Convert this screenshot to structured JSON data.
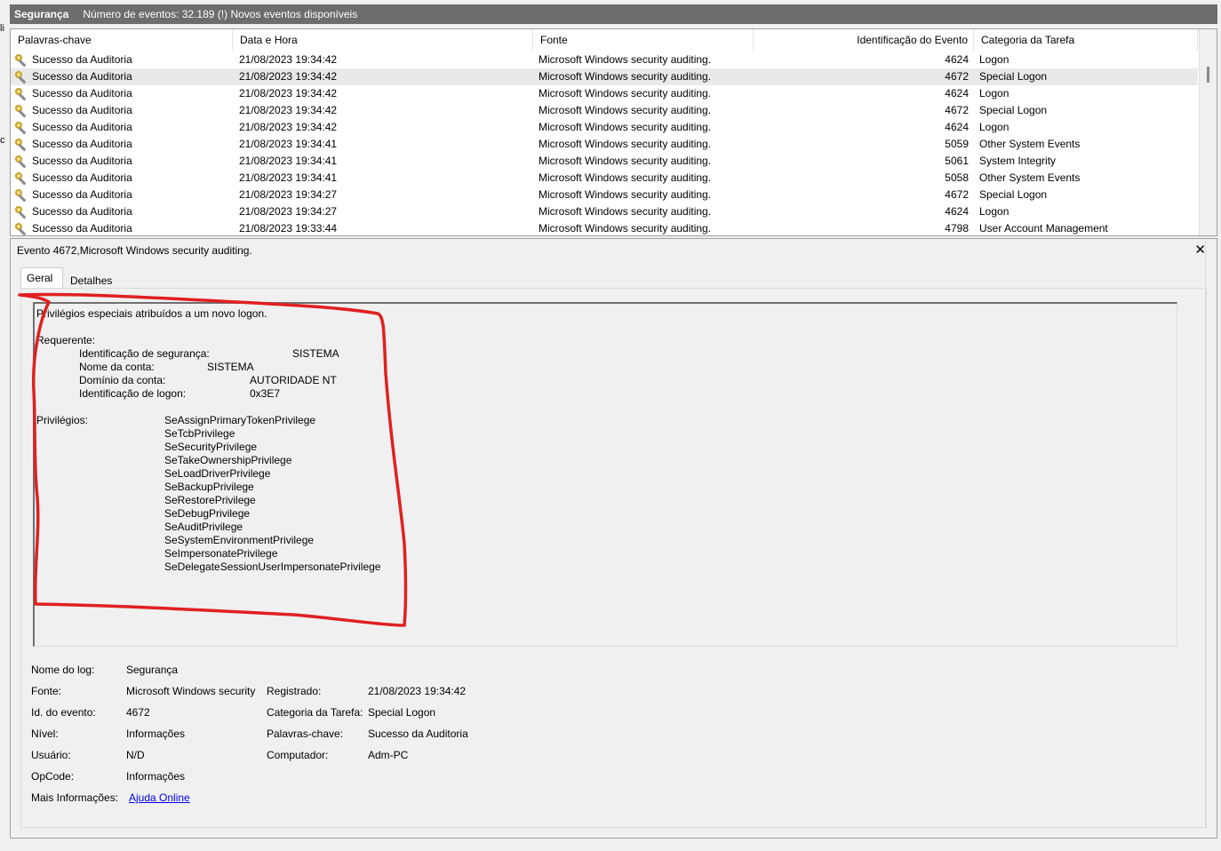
{
  "window": {
    "log_name": "Segurança",
    "event_count_text": "Número de eventos: 32.189 (!) Novos eventos disponíveis"
  },
  "list": {
    "columns": [
      "Palavras-chave",
      "Data e Hora",
      "Fonte",
      "Identificação do Evento",
      "Categoria da Tarefa"
    ],
    "rows": [
      {
        "kw": "Sucesso da Auditoria",
        "dt": "21/08/2023 19:34:42",
        "src": "Microsoft Windows security auditing.",
        "id": "4624",
        "cat": "Logon"
      },
      {
        "kw": "Sucesso da Auditoria",
        "dt": "21/08/2023 19:34:42",
        "src": "Microsoft Windows security auditing.",
        "id": "4672",
        "cat": "Special Logon"
      },
      {
        "kw": "Sucesso da Auditoria",
        "dt": "21/08/2023 19:34:42",
        "src": "Microsoft Windows security auditing.",
        "id": "4624",
        "cat": "Logon"
      },
      {
        "kw": "Sucesso da Auditoria",
        "dt": "21/08/2023 19:34:42",
        "src": "Microsoft Windows security auditing.",
        "id": "4672",
        "cat": "Special Logon"
      },
      {
        "kw": "Sucesso da Auditoria",
        "dt": "21/08/2023 19:34:42",
        "src": "Microsoft Windows security auditing.",
        "id": "4624",
        "cat": "Logon"
      },
      {
        "kw": "Sucesso da Auditoria",
        "dt": "21/08/2023 19:34:41",
        "src": "Microsoft Windows security auditing.",
        "id": "5059",
        "cat": "Other System Events"
      },
      {
        "kw": "Sucesso da Auditoria",
        "dt": "21/08/2023 19:34:41",
        "src": "Microsoft Windows security auditing.",
        "id": "5061",
        "cat": "System Integrity"
      },
      {
        "kw": "Sucesso da Auditoria",
        "dt": "21/08/2023 19:34:41",
        "src": "Microsoft Windows security auditing.",
        "id": "5058",
        "cat": "Other System Events"
      },
      {
        "kw": "Sucesso da Auditoria",
        "dt": "21/08/2023 19:34:27",
        "src": "Microsoft Windows security auditing.",
        "id": "4672",
        "cat": "Special Logon"
      },
      {
        "kw": "Sucesso da Auditoria",
        "dt": "21/08/2023 19:34:27",
        "src": "Microsoft Windows security auditing.",
        "id": "4624",
        "cat": "Logon"
      },
      {
        "kw": "Sucesso da Auditoria",
        "dt": "21/08/2023 19:33:44",
        "src": "Microsoft Windows security auditing.",
        "id": "4798",
        "cat": "User Account Management"
      }
    ],
    "selected_index": 1
  },
  "detail": {
    "title": "Evento 4672,Microsoft Windows security auditing.",
    "tabs": [
      "Geral",
      "Detalhes"
    ],
    "message": {
      "summary": "Privilégios especiais atribuídos a um novo logon.",
      "requester_label": "Requerente:",
      "sid_label": "Identificação de segurança:",
      "sid_value": "SISTEMA",
      "account_label": "Nome da conta:",
      "account_value": "SISTEMA",
      "domain_label": "Domínio da conta:",
      "domain_value": "AUTORIDADE NT",
      "logon_id_label": "Identificação de logon:",
      "logon_id_value": "0x3E7",
      "privileges_label": "Privilégios:",
      "privileges": [
        "SeAssignPrimaryTokenPrivilege",
        "SeTcbPrivilege",
        "SeSecurityPrivilege",
        "SeTakeOwnershipPrivilege",
        "SeLoadDriverPrivilege",
        "SeBackupPrivilege",
        "SeRestorePrivilege",
        "SeDebugPrivilege",
        "SeAuditPrivilege",
        "SeSystemEnvironmentPrivilege",
        "SeImpersonatePrivilege",
        "SeDelegateSessionUserImpersonatePrivilege"
      ]
    },
    "properties": {
      "log_name_label": "Nome do log:",
      "log_name_value": "Segurança",
      "source_label": "Fonte:",
      "source_value": "Microsoft Windows security",
      "logged_label": "Registrado:",
      "logged_value": "21/08/2023 19:34:42",
      "event_id_label": "Id. do evento:",
      "event_id_value": "4672",
      "task_category_label": "Categoria da Tarefa:",
      "task_category_value": "Special Logon",
      "level_label": "Nível:",
      "level_value": "Informações",
      "keywords_label": "Palavras-chave:",
      "keywords_value": "Sucesso da Auditoria",
      "user_label": "Usuário:",
      "user_value": "N/D",
      "computer_label": "Computador:",
      "computer_value": "Adm-PC",
      "opcode_label": "OpCode:",
      "opcode_value": "Informações",
      "more_info_label": "Mais Informações:",
      "more_info_link": "Ajuda Online"
    }
  },
  "edge_fragments": [
    "li",
    "c"
  ],
  "colors": {
    "titlebar": "#6d6d6d",
    "selected_row": "#e9e9e9",
    "annotation": "#e02020",
    "link": "#0000ee"
  },
  "icons": {
    "row_icon": "key-icon",
    "close": "close-icon"
  }
}
